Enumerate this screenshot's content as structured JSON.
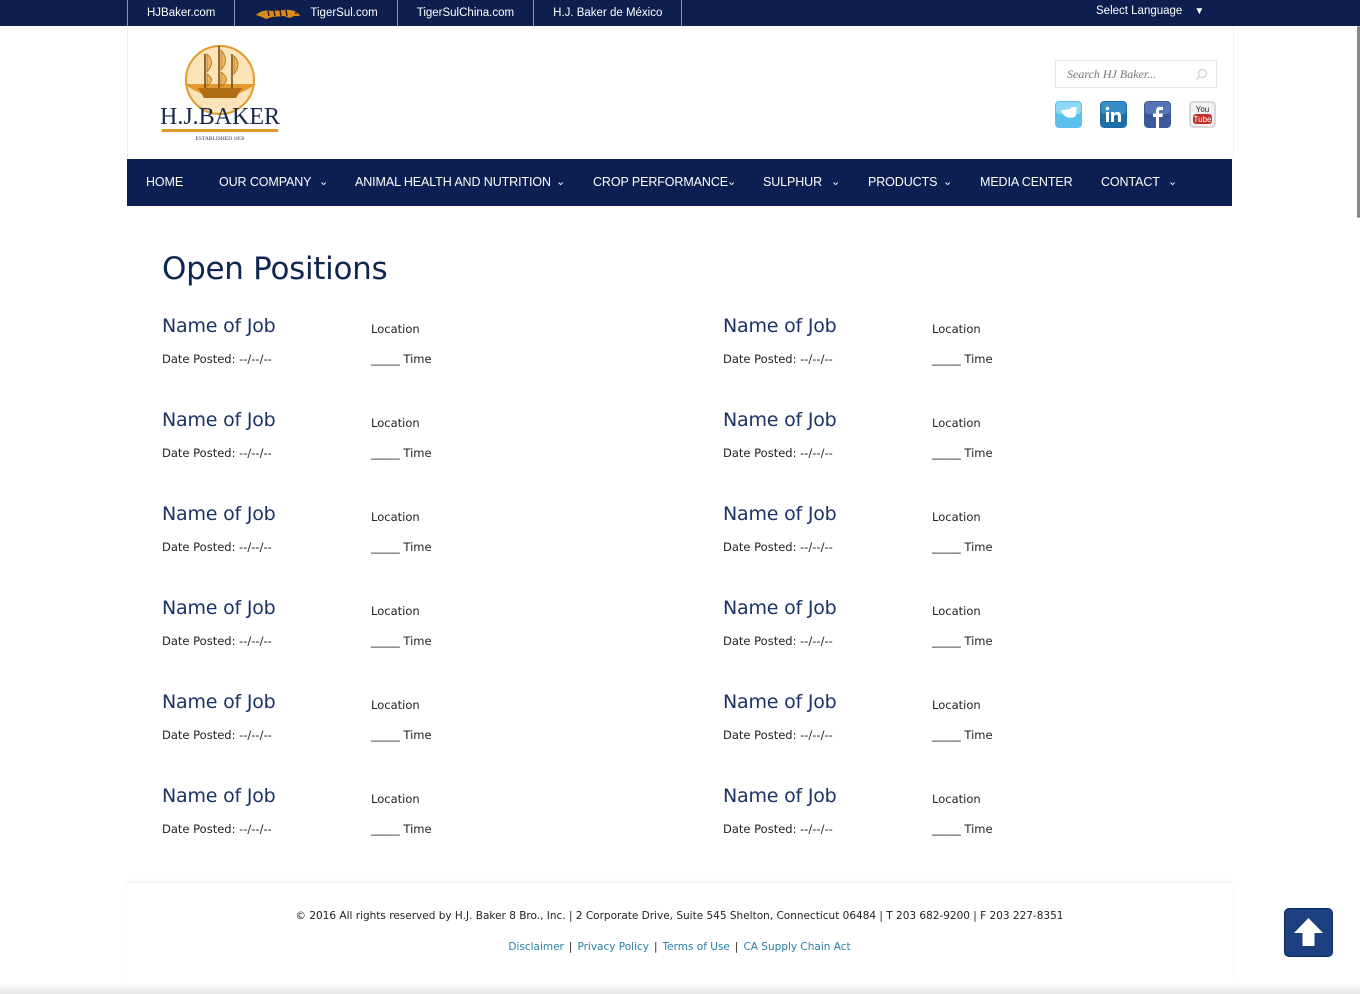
{
  "topbar": {
    "sites": [
      {
        "label": "HJBaker.com"
      },
      {
        "label": "TigerSul.com"
      },
      {
        "label": "TigerSulChina.com"
      },
      {
        "label": "H.J. Baker de México"
      }
    ],
    "language": "Select Language"
  },
  "header": {
    "logo_text": "H.J.BAKER",
    "logo_subtext": "ESTABLISHED 1850",
    "search_placeholder": "Search HJ Baker...",
    "social": [
      "twitter-icon",
      "linkedin-icon",
      "facebook-icon",
      "youtube-icon"
    ]
  },
  "nav": {
    "items": [
      {
        "label": "Home",
        "dropdown": false
      },
      {
        "label": "Our Company",
        "dropdown": true
      },
      {
        "label": "Animal Health and Nutrition",
        "dropdown": true
      },
      {
        "label": "Crop Performance",
        "dropdown": true
      },
      {
        "label": "Sulphur",
        "dropdown": true
      },
      {
        "label": "Products",
        "dropdown": true
      },
      {
        "label": "Media Center",
        "dropdown": false
      },
      {
        "label": "Contact",
        "dropdown": true
      }
    ]
  },
  "page": {
    "title": "Open Positions",
    "jobs": [
      {
        "name": "Name of Job",
        "location": "Location",
        "date": "Date Posted: --/--/--",
        "time": "_____ Time"
      },
      {
        "name": "Name of Job",
        "location": "Location",
        "date": "Date Posted: --/--/--",
        "time": "_____ Time"
      },
      {
        "name": "Name of Job",
        "location": "Location",
        "date": "Date Posted: --/--/--",
        "time": "_____ Time"
      },
      {
        "name": "Name of Job",
        "location": "Location",
        "date": "Date Posted: --/--/--",
        "time": "_____ Time"
      },
      {
        "name": "Name of Job",
        "location": "Location",
        "date": "Date Posted: --/--/--",
        "time": "_____ Time"
      },
      {
        "name": "Name of Job",
        "location": "Location",
        "date": "Date Posted: --/--/--",
        "time": "_____ Time"
      },
      {
        "name": "Name of Job",
        "location": "Location",
        "date": "Date Posted: --/--/--",
        "time": "_____ Time"
      },
      {
        "name": "Name of Job",
        "location": "Location",
        "date": "Date Posted: --/--/--",
        "time": "_____ Time"
      },
      {
        "name": "Name of Job",
        "location": "Location",
        "date": "Date Posted: --/--/--",
        "time": "_____ Time"
      },
      {
        "name": "Name of Job",
        "location": "Location",
        "date": "Date Posted: --/--/--",
        "time": "_____ Time"
      },
      {
        "name": "Name of Job",
        "location": "Location",
        "date": "Date Posted: --/--/--",
        "time": "_____ Time"
      },
      {
        "name": "Name of Job",
        "location": "Location",
        "date": "Date Posted: --/--/--",
        "time": "_____ Time"
      }
    ]
  },
  "footer": {
    "copyright": "© 2016 All rights reserved by H.J. Baker 8 Bro., Inc. | 2 Corporate Drive, Suite 545 Shelton, Connecticut 06484 | T 203 682-9200 | F 203 227-8351",
    "links": [
      "Disclaimer",
      "Privacy Policy",
      "Terms of Use",
      "CA Supply Chain Act"
    ]
  },
  "colors": {
    "navy": "#0b1f52",
    "title": "#0f2552",
    "link": "#2a7fa6",
    "logo_orange": "#e39a2d"
  }
}
